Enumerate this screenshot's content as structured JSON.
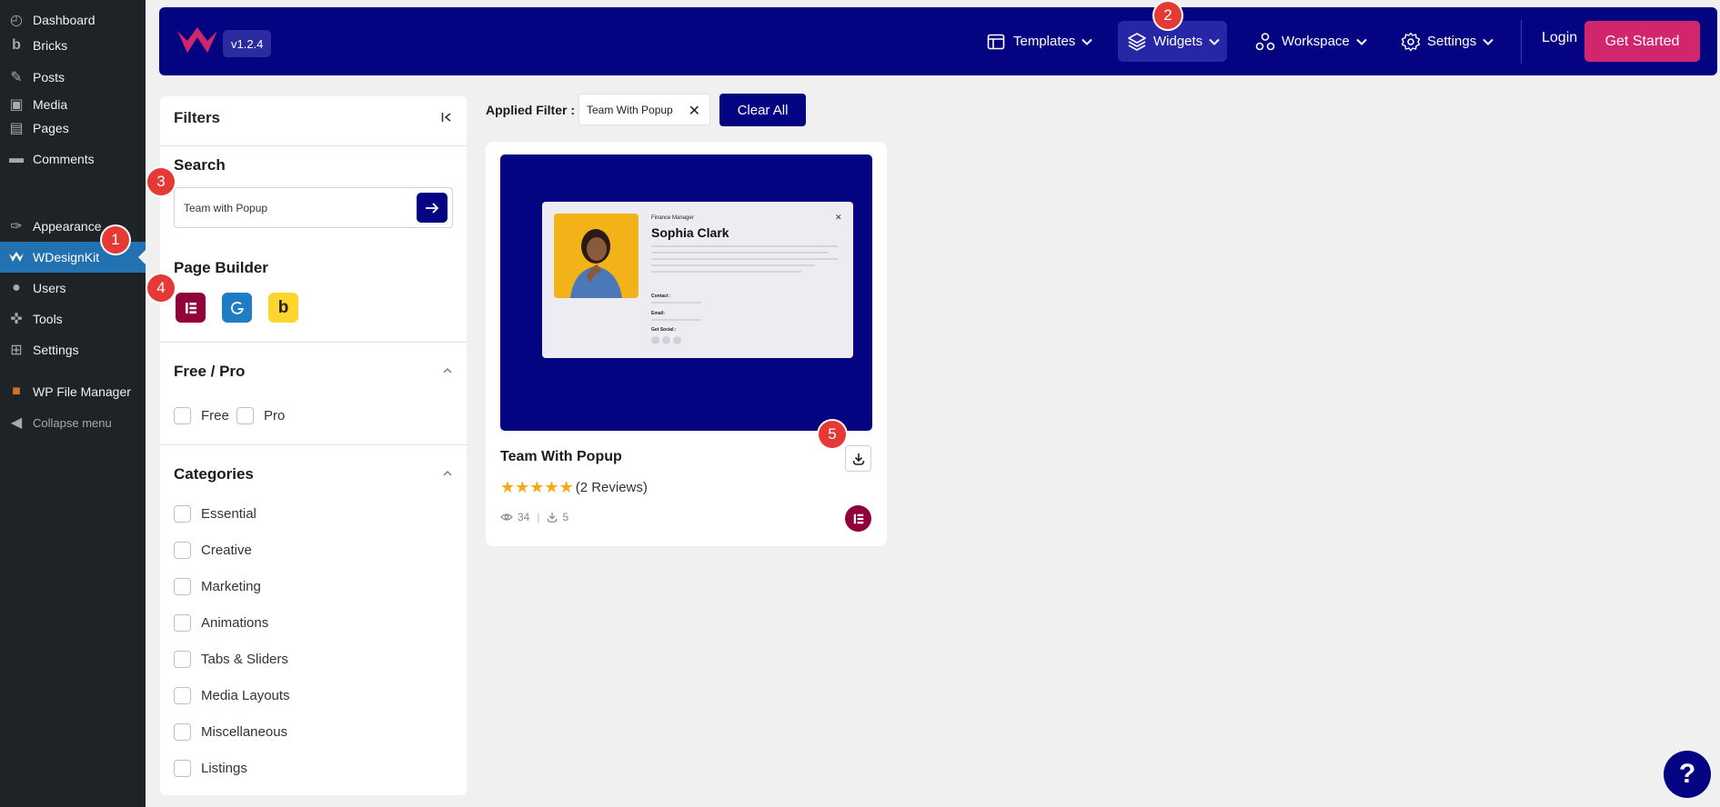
{
  "wp_menu": {
    "dashboard": "Dashboard",
    "bricks": "Bricks",
    "posts": "Posts",
    "media": "Media",
    "pages": "Pages",
    "comments": "Comments",
    "appearance": "Appearance",
    "wdesignkit": "WDesignKit",
    "users": "Users",
    "tools": "Tools",
    "settings": "Settings",
    "wp_file_manager": "WP File Manager",
    "collapse": "Collapse menu"
  },
  "topnav": {
    "version": "v1.2.4",
    "templates": "Templates",
    "widgets": "Widgets",
    "workspace": "Workspace",
    "settings": "Settings",
    "login": "Login",
    "get_started": "Get Started"
  },
  "filters": {
    "title": "Filters",
    "search_heading": "Search",
    "search_value": "Team with Popup",
    "page_builder_heading": "Page Builder",
    "free_pro_heading": "Free / Pro",
    "free": "Free",
    "pro": "Pro",
    "categories_heading": "Categories",
    "categories": [
      "Essential",
      "Creative",
      "Marketing",
      "Animations",
      "Tabs & Sliders",
      "Media Layouts",
      "Miscellaneous",
      "Listings"
    ]
  },
  "applied": {
    "label": "Applied Filter :",
    "chip": "Team With Popup",
    "clear_all": "Clear All"
  },
  "card": {
    "title": "Team With Popup",
    "rating": 5,
    "reviews": "(2 Reviews)",
    "views": "34",
    "downloads": "5",
    "preview": {
      "role": "Finance Manager",
      "name": "Sophia Clark",
      "contact": "Contact :",
      "email": "Email:",
      "social": "Get Social :"
    }
  },
  "markers": [
    "1",
    "2",
    "3",
    "4",
    "5"
  ],
  "help": "?",
  "colors": {
    "brand_navy": "#040483",
    "accent_pink": "#d1266d",
    "wp_sidebar": "#1d2327",
    "wp_active": "#2271b1",
    "marker_red": "#e53935",
    "star": "#f6a917",
    "elementor": "#92003b",
    "gutenberg": "#1f7dc4",
    "bricks": "#fed42f"
  }
}
